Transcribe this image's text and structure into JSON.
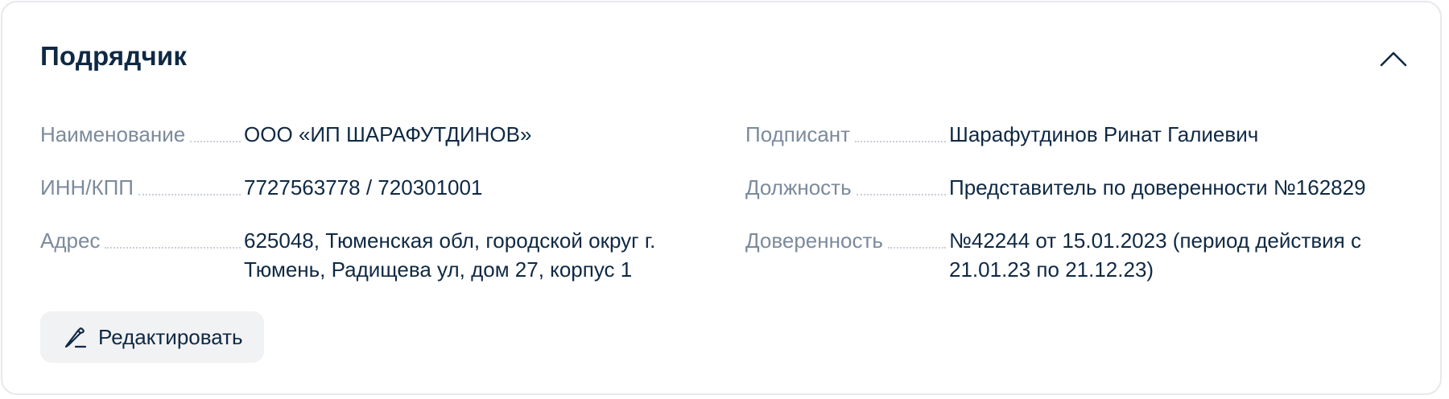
{
  "section": {
    "title": "Подрядчик",
    "collapse_icon": "chevron-up-icon"
  },
  "left_fields": [
    {
      "label": "Наименование",
      "value": "ООО «ИП ШАРАФУТДИНОВ»"
    },
    {
      "label": "ИНН/КПП",
      "value": "7727563778 / 720301001"
    },
    {
      "label": "Адрес",
      "value": "625048, Тюменская обл, городской округ г. Тюмень, Радищева ул, дом 27, корпус 1"
    }
  ],
  "right_fields": [
    {
      "label": "Подписант",
      "value": "Шарафутдинов Ринат Галиевич"
    },
    {
      "label": "Должность",
      "value": "Представитель по доверенности №162829"
    },
    {
      "label": "Доверенность",
      "value": "№42244 от 15.01.2023 (период действия с 21.01.23 по 21.12.23)"
    }
  ],
  "actions": {
    "edit_label": "Редактировать",
    "edit_icon": "pencil-icon"
  },
  "colors": {
    "text": "#0f2944",
    "label": "#7c8a9c",
    "button_bg": "#f1f2f4",
    "border": "#e6e8ec"
  }
}
